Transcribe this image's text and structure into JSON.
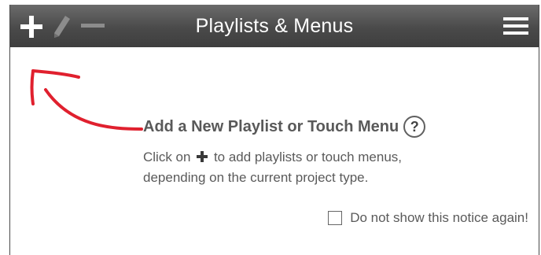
{
  "window": {
    "title": "Playlists & Menus"
  },
  "toolbar": {
    "add_icon": "plus-icon",
    "edit_icon": "pencil-icon",
    "remove_icon": "minus-icon",
    "menu_icon": "hamburger-menu-icon"
  },
  "notice": {
    "heading": "Add a New Playlist or Touch Menu",
    "help_symbol": "?",
    "desc_before": "Click on",
    "desc_after": "to add playlists or touch menus,",
    "desc_line2": "depending on the current project type.",
    "checkbox_label": "Do not show this notice again!",
    "checkbox_checked": false
  },
  "colors": {
    "header": "#4a4a4a",
    "annotation_arrow": "#e0202e",
    "text": "#5a5a5a"
  }
}
